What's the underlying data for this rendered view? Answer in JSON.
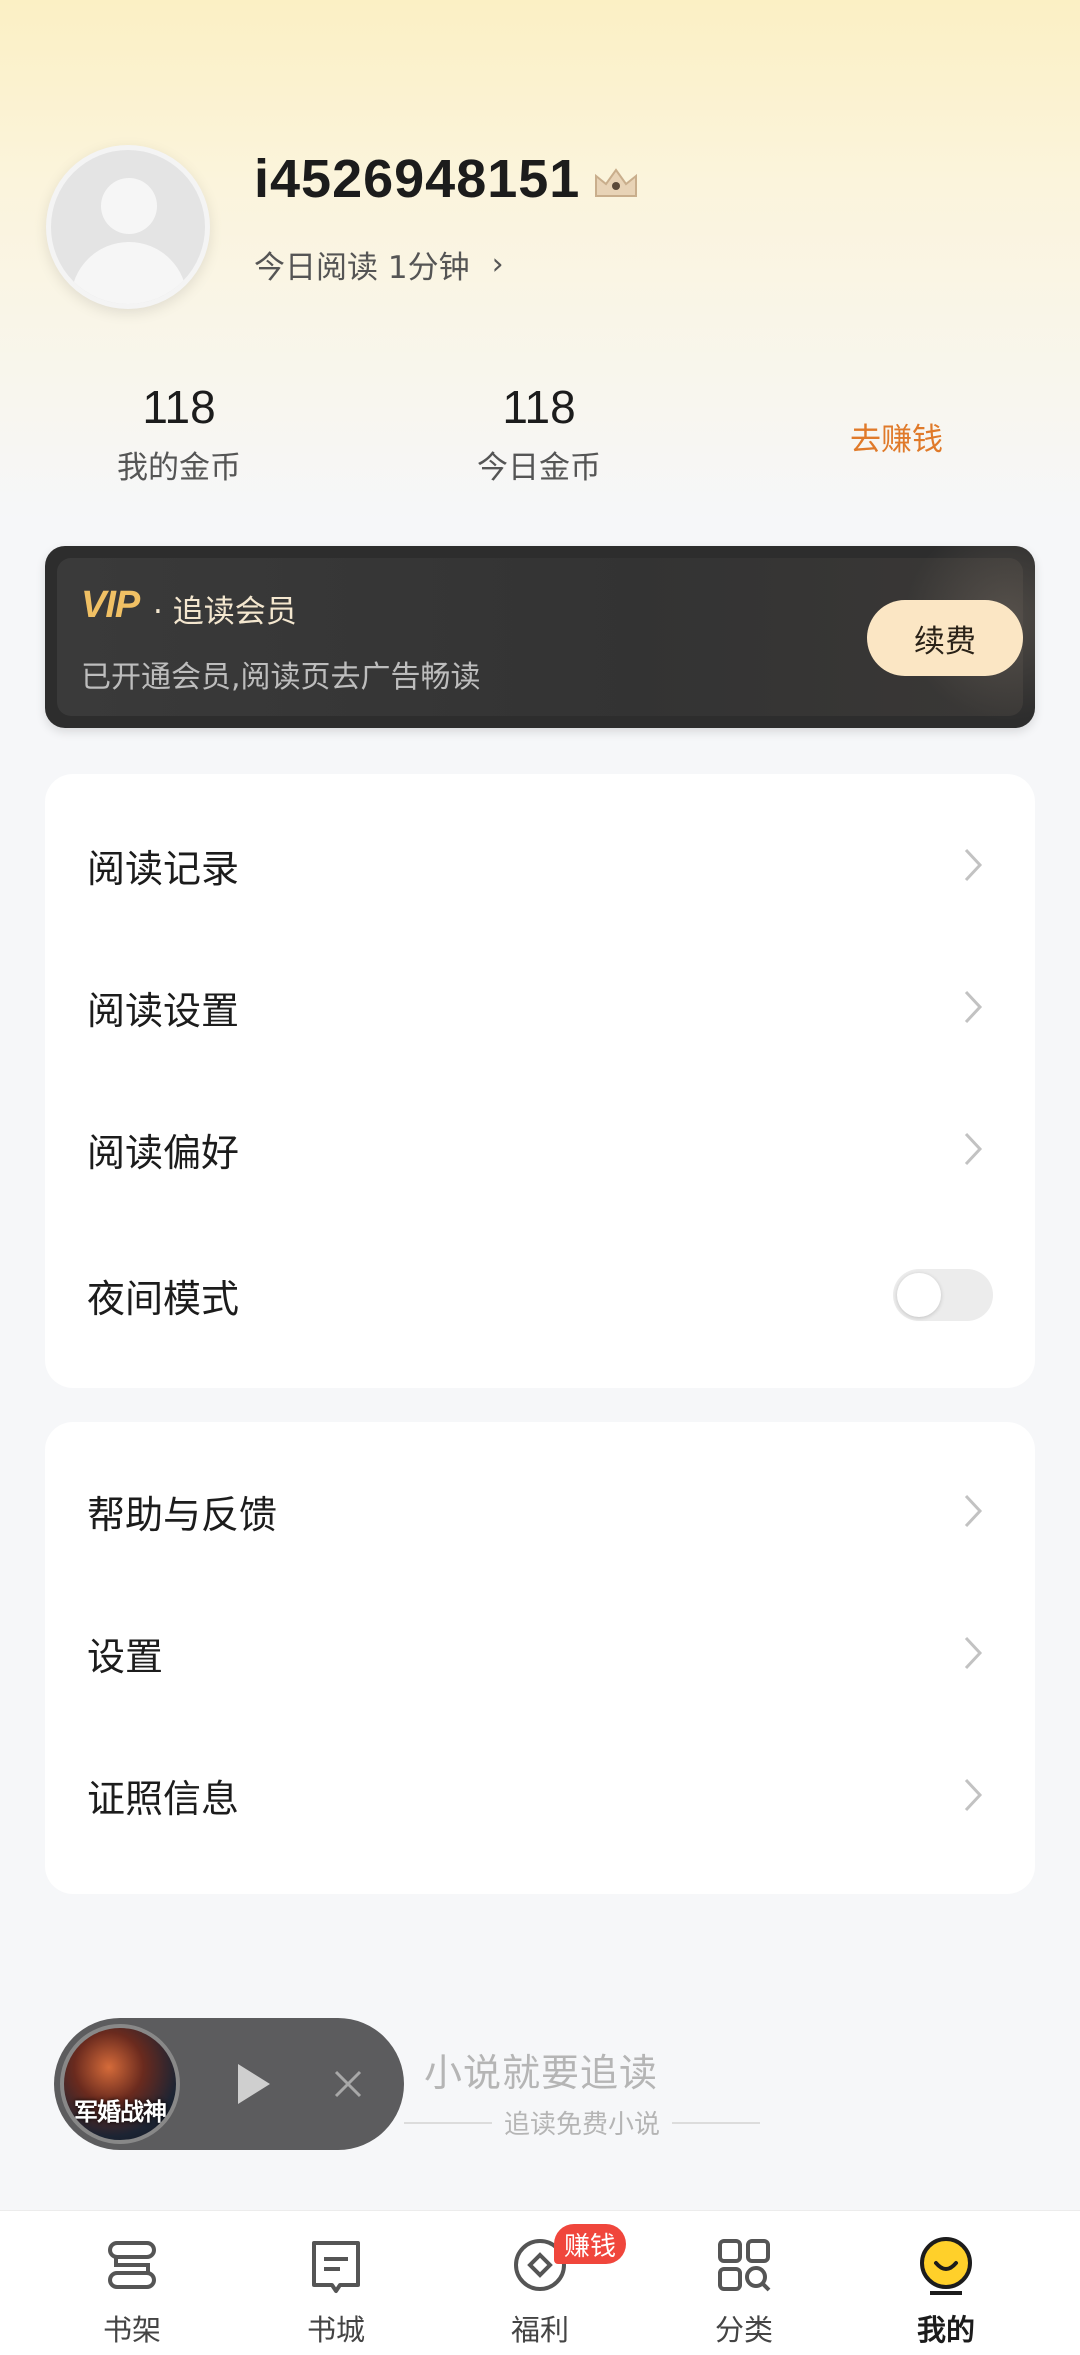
{
  "profile": {
    "username": "i4526948151",
    "today_read": "今日阅读 1分钟"
  },
  "stats": {
    "my_coins_value": "118",
    "my_coins_label": "我的金币",
    "today_coins_value": "118",
    "today_coins_label": "今日金币",
    "earn_link": "去赚钱"
  },
  "vip": {
    "logo": "VIP",
    "title": "· 追读会员",
    "subtitle": "已开通会员,阅读页去广告畅读",
    "renew_label": "续费"
  },
  "menu_group_1": [
    {
      "label": "阅读记录"
    },
    {
      "label": "阅读设置"
    },
    {
      "label": "阅读偏好"
    },
    {
      "label": "夜间模式",
      "toggle": false
    }
  ],
  "menu_group_2": [
    {
      "label": "帮助与反馈"
    },
    {
      "label": "设置"
    },
    {
      "label": "证照信息"
    }
  ],
  "player": {
    "cover_text": "军婚战神",
    "slogan": "小说就要追读",
    "slogan_sub": "追读免费小说"
  },
  "bottom_nav": {
    "items": [
      {
        "label": "书架",
        "icon": "bookshelf-icon"
      },
      {
        "label": "书城",
        "icon": "book-store-icon"
      },
      {
        "label": "福利",
        "icon": "welfare-icon"
      },
      {
        "label": "分类",
        "icon": "category-icon"
      },
      {
        "label": "我的",
        "icon": "profile-face-icon",
        "active": true
      }
    ],
    "badge": "赚钱"
  },
  "colors": {
    "accent_orange": "#e07a2a",
    "vip_gold": "#f0c064",
    "badge_red": "#f0463c",
    "active_yellow": "#ffd02a"
  }
}
